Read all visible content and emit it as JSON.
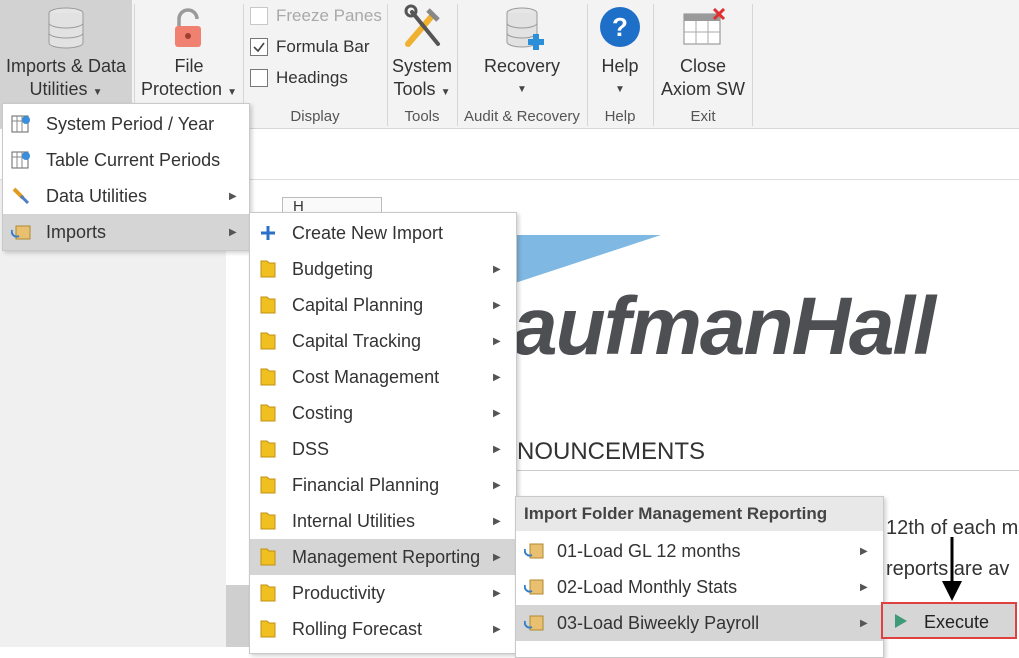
{
  "ribbon": {
    "imports_data": {
      "line1": "Imports & Data",
      "line2": "Utilities"
    },
    "file_protection": {
      "line1": "File",
      "line2": "Protection"
    },
    "display": {
      "freeze_panes": "Freeze Panes",
      "formula_bar": "Formula Bar",
      "headings": "Headings",
      "group": "Display"
    },
    "system_tools": {
      "line1": "System",
      "line2": "Tools",
      "group": "Tools"
    },
    "recovery": {
      "label": "Recovery",
      "group": "Audit & Recovery"
    },
    "help": {
      "label": "Help",
      "group": "Help"
    },
    "close": {
      "line1": "Close",
      "line2": "Axiom SW",
      "group": "Exit"
    }
  },
  "home_tab": "H",
  "brand": "aufmanHall",
  "announcements": "NOUNCEMENTS",
  "body_lines": [
    "12th of each m",
    "reports are av"
  ],
  "menu1": {
    "items": [
      "System Period / Year",
      "Table Current Periods",
      "Data Utilities",
      "Imports"
    ]
  },
  "menu2": {
    "items": [
      "Create New Import",
      "Budgeting",
      "Capital Planning",
      "Capital Tracking",
      "Cost Management",
      "Costing",
      "DSS",
      "Financial Planning",
      "Internal Utilities",
      "Management Reporting",
      "Productivity",
      "Rolling Forecast"
    ]
  },
  "menu3": {
    "header": "Import Folder Management Reporting",
    "items": [
      "01-Load GL 12 months",
      "02-Load Monthly Stats",
      "03-Load Biweekly Payroll"
    ]
  },
  "menu4": {
    "execute": "Execute"
  }
}
